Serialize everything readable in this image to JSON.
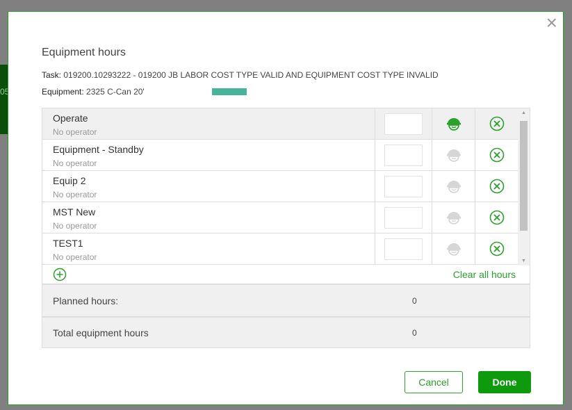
{
  "background": {
    "fragment": "05"
  },
  "dialog": {
    "title": "Equipment hours",
    "task_label": "Task:",
    "task_value": "019200.10293222 - 019200 JB LABOR COST TYPE VALID AND EQUIPMENT COST TYPE INVALID",
    "equipment_label": "Equipment:",
    "equipment_value": "2325 C-Can 20'",
    "close": "×"
  },
  "rows": [
    {
      "name": "Operate",
      "operator": "No operator",
      "hours": "",
      "operator_active": true
    },
    {
      "name": "Equipment - Standby",
      "operator": "No operator",
      "hours": "",
      "operator_active": false
    },
    {
      "name": "Equip 2",
      "operator": "No operator",
      "hours": "",
      "operator_active": false
    },
    {
      "name": "MST New",
      "operator": "No operator",
      "hours": "",
      "operator_active": false
    },
    {
      "name": "TEST1",
      "operator": "No operator",
      "hours": "",
      "operator_active": false
    }
  ],
  "clear_all": "Clear all hours",
  "summary": {
    "planned_label": "Planned hours:",
    "planned_value": "0",
    "total_label": "Total equipment hours",
    "total_value": "0"
  },
  "buttons": {
    "cancel": "Cancel",
    "done": "Done"
  },
  "colors": {
    "accent": "#2aa12a",
    "inactive": "#d6d6d6"
  }
}
